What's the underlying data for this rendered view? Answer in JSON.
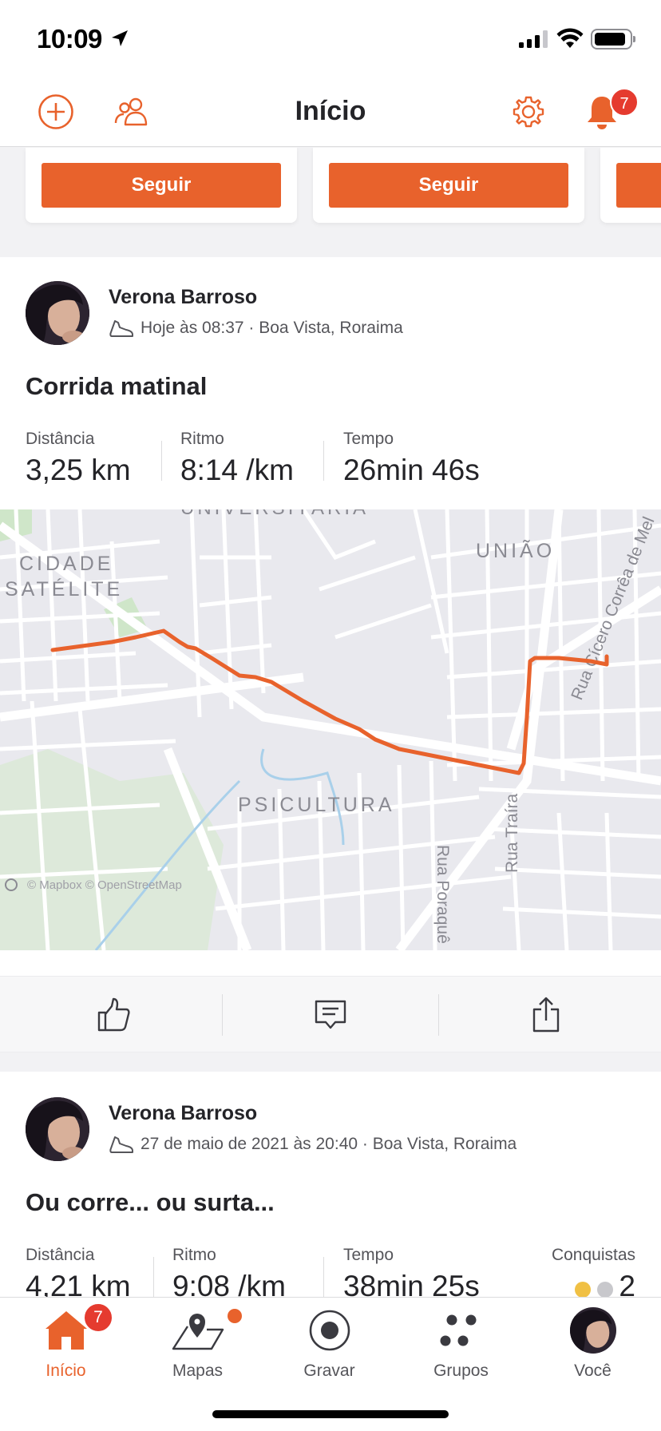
{
  "status_bar": {
    "time": "10:09"
  },
  "header": {
    "title": "Início",
    "notification_count": "7"
  },
  "suggestions": {
    "follow_label": "Seguir"
  },
  "activities": [
    {
      "athlete": "Verona Barroso",
      "meta": "Hoje às 08:37 · Boa Vista, Roraima",
      "title": "Corrida matinal",
      "stats": [
        {
          "label": "Distância",
          "value": "3,25 km"
        },
        {
          "label": "Ritmo",
          "value": "8:14 /km"
        },
        {
          "label": "Tempo",
          "value": "26min 46s"
        }
      ],
      "map": {
        "labels": [
          "UNIVERSITÁRIA",
          "CIDADE",
          "SATÉLITE",
          "UNIÃO",
          "PSICULTURA",
          "Rua Cícero Corrêa de Mel",
          "Rua Poraquê",
          "Rua Traíra"
        ],
        "attribution": "© Mapbox © OpenStreetMap",
        "route_color": "#e8622c"
      }
    },
    {
      "athlete": "Verona Barroso",
      "meta": "27 de maio de 2021 às 20:40 · Boa Vista, Roraima",
      "title": "Ou corre... ou surta...",
      "stats": [
        {
          "label": "Distância",
          "value": "4,21 km"
        },
        {
          "label": "Ritmo",
          "value": "9:08 /km"
        },
        {
          "label": "Tempo",
          "value": "38min 25s"
        },
        {
          "label": "Conquistas",
          "value": "2"
        }
      ]
    }
  ],
  "tab_bar": {
    "tabs": [
      {
        "label": "Início",
        "icon": "home-icon",
        "badge": "7"
      },
      {
        "label": "Mapas",
        "icon": "map-icon"
      },
      {
        "label": "Gravar",
        "icon": "record-icon"
      },
      {
        "label": "Grupos",
        "icon": "groups-icon"
      },
      {
        "label": "Você",
        "icon": "avatar"
      }
    ]
  },
  "colors": {
    "accent": "#e8622c",
    "badge": "#e53b2f",
    "text": "#242428",
    "muted": "#55555a"
  }
}
